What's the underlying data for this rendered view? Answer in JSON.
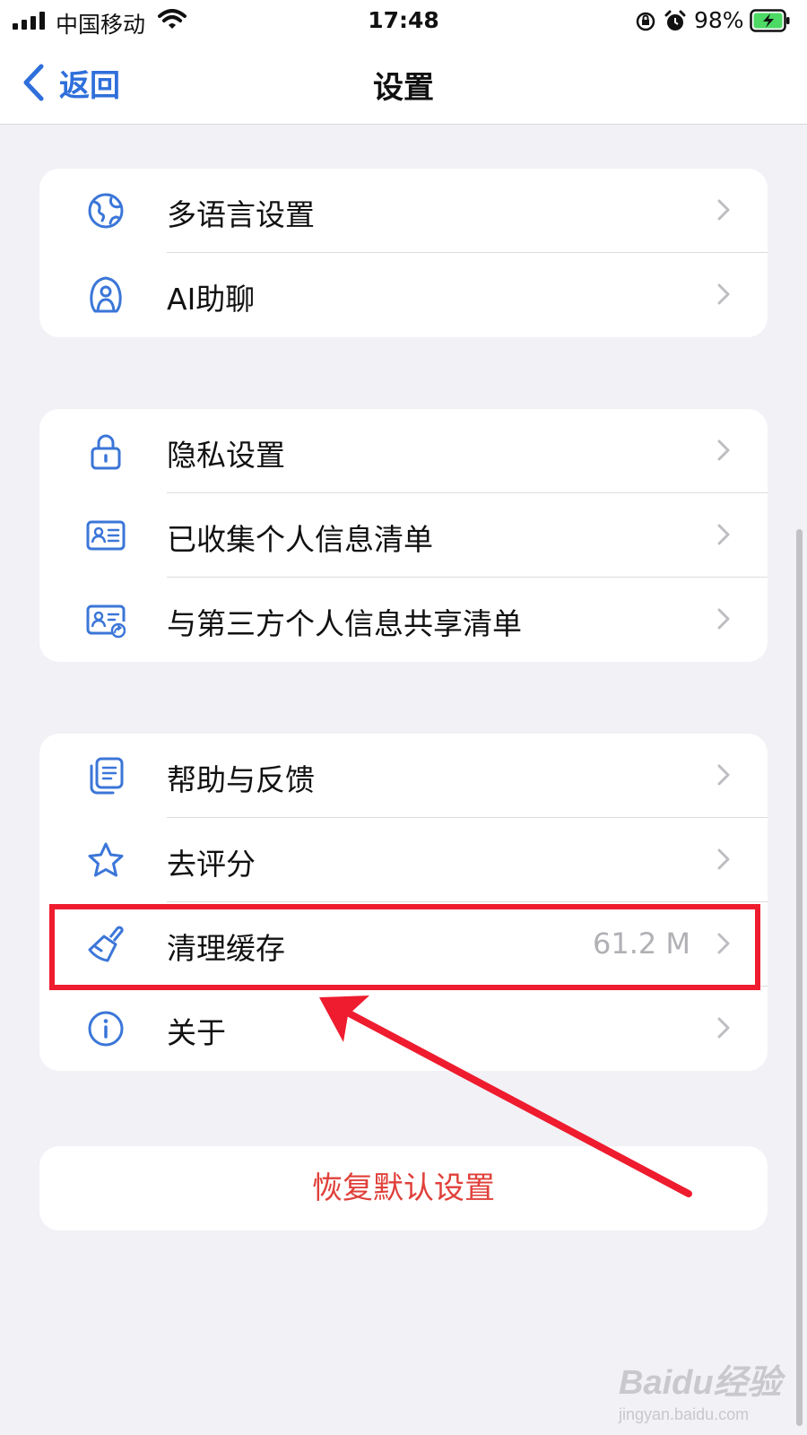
{
  "status_bar": {
    "carrier": "中国移动",
    "time": "17:48",
    "battery": "98%"
  },
  "nav": {
    "back_label": "返回",
    "title": "设置"
  },
  "groups": [
    {
      "items": [
        {
          "label": "多语言设置",
          "icon": "globe-icon"
        },
        {
          "label": "AI助聊",
          "icon": "ai-assistant-icon"
        }
      ]
    },
    {
      "items": [
        {
          "label": "隐私设置",
          "icon": "lock-icon"
        },
        {
          "label": "已收集个人信息清单",
          "icon": "id-card-icon"
        },
        {
          "label": "与第三方个人信息共享清单",
          "icon": "id-card-share-icon"
        }
      ]
    },
    {
      "items": [
        {
          "label": "帮助与反馈",
          "icon": "document-stack-icon"
        },
        {
          "label": "去评分",
          "icon": "star-icon"
        },
        {
          "label": "清理缓存",
          "icon": "brush-icon",
          "value": "61.2 M"
        },
        {
          "label": "关于",
          "icon": "info-icon"
        }
      ]
    }
  ],
  "reset_label": "恢复默认设置",
  "colors": {
    "accent": "#2f6fdb",
    "danger": "#e0403a",
    "annotation": "#ee1c2e",
    "background": "#f1f1f6"
  },
  "watermark": {
    "main": "Baidu经验",
    "sub": "jingyan.baidu.com"
  }
}
